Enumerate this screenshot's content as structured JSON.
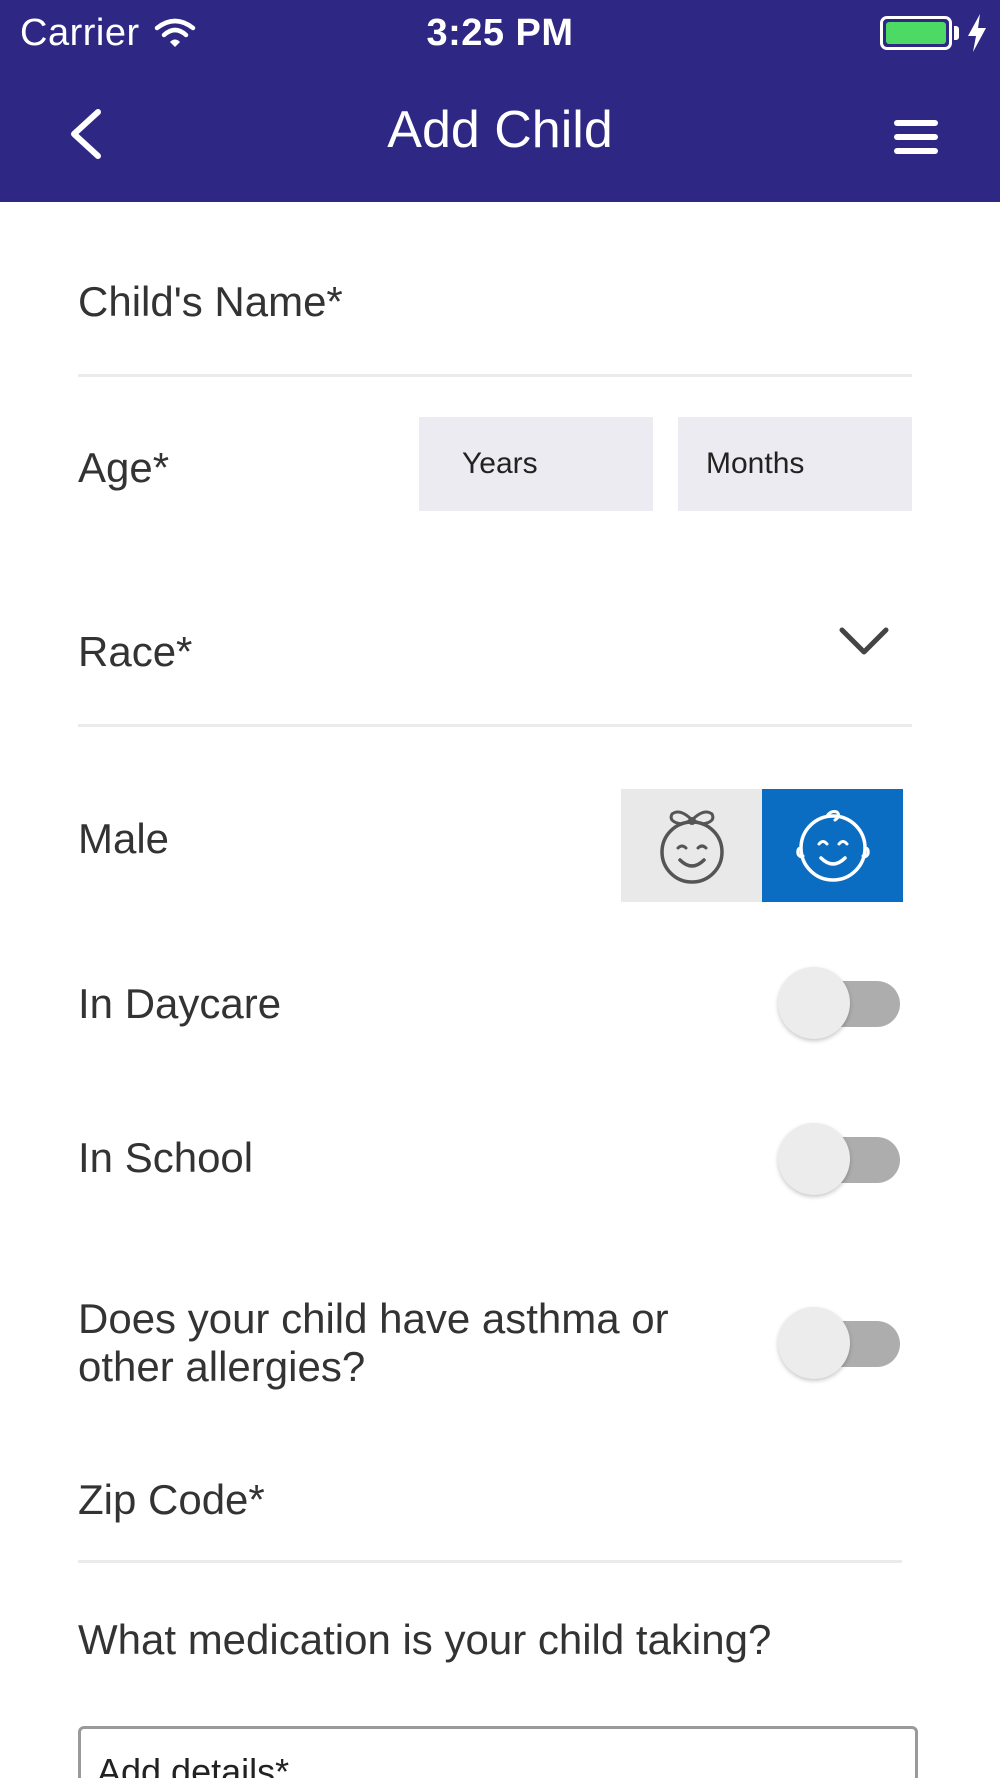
{
  "status_bar": {
    "carrier": "Carrier",
    "time": "3:25 PM",
    "battery_color": "#4cd964"
  },
  "nav": {
    "title": "Add Child",
    "back_icon": "chevron-left-icon",
    "menu_icon": "hamburger-menu-icon"
  },
  "colors": {
    "header_bg": "#2e2884",
    "selected_gender_bg": "#0a6dc2"
  },
  "form": {
    "child_name_label": "Child's Name*",
    "age_label": "Age*",
    "years_placeholder": "Years",
    "months_placeholder": "Months",
    "race_label": "Race*",
    "gender_label": "Male",
    "gender_selected": "male",
    "daycare_label": "In Daycare",
    "daycare_on": false,
    "school_label": "In School",
    "school_on": false,
    "asthma_label_line1": "Does your child have asthma or",
    "asthma_label_line2": "other allergies?",
    "asthma_on": false,
    "zip_label": "Zip Code*",
    "medication_label": "What medication is your child taking?",
    "details_placeholder": "Add details*"
  }
}
